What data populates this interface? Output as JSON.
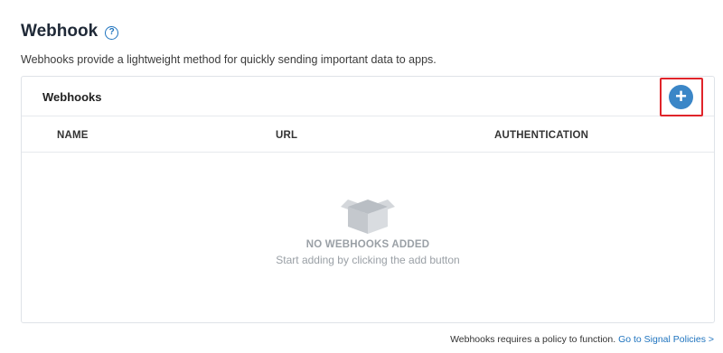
{
  "header": {
    "title": "Webhook",
    "help_icon": "?",
    "description": "Webhooks provide a lightweight method for quickly sending important data to apps."
  },
  "card": {
    "title": "Webhooks",
    "add_icon": "+",
    "columns": [
      "NAME",
      "URL",
      "AUTHENTICATION"
    ],
    "empty_title": "NO WEBHOOKS ADDED",
    "empty_subtitle": "Start adding by clicking the add button"
  },
  "footer": {
    "text": "Webhooks requires a policy to function.",
    "link": "Go to Signal Policies >"
  },
  "colors": {
    "accent": "#3b86c7",
    "highlight": "#e0242a",
    "muted": "#9aa0a6"
  }
}
